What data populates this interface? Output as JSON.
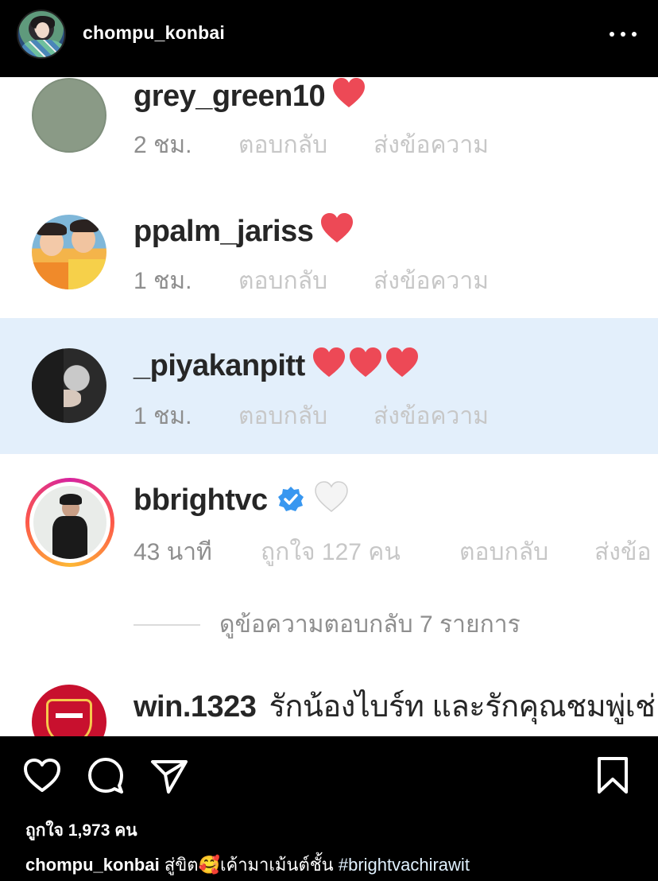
{
  "header": {
    "username": "chompu_konbai",
    "more_icon": "more-horizontal-icon"
  },
  "comments": [
    {
      "username": "grey_green10",
      "reaction": "❤️",
      "time": "2 ชม.",
      "reply": "ตอบกลับ",
      "send": "ส่งข้อความ",
      "avatar_color": "#8a9a86",
      "highlighted": false
    },
    {
      "username": "ppalm_jariss",
      "reaction": "❤️",
      "time": "1 ชม.",
      "reply": "ตอบกลับ",
      "send": "ส่งข้อความ",
      "highlighted": false
    },
    {
      "username": "_piyakanpitt",
      "reaction": "❤️❤️❤️",
      "time": "1 ชม.",
      "reply": "ตอบกลับ",
      "send": "ส่งข้อความ",
      "highlighted": true
    },
    {
      "username": "bbrightvc",
      "verified": true,
      "reaction": "🤍",
      "time": "43 นาที",
      "likes": "ถูกใจ 127 คน",
      "reply": "ตอบกลับ",
      "send": "ส่งข้อ",
      "highlighted": false
    },
    {
      "username": "win.1323",
      "text": "รักน้องไบร์ท และรักคุณชมพู่เช่",
      "highlighted": false
    }
  ],
  "view_replies": "ดูข้อความตอบกลับ 7 รายการ",
  "colors": {
    "highlight_bg": "#e3effb",
    "heart_red": "#ed4956",
    "verified_blue": "#3897f0"
  },
  "actions": {
    "like_icon": "heart-outline-icon",
    "comment_icon": "comment-bubble-icon",
    "share_icon": "send-paper-plane-icon",
    "save_icon": "bookmark-icon"
  },
  "post": {
    "likes": "ถูกใจ 1,973 คน",
    "caption_user": "chompu_konbai",
    "caption_text": "สู่ขิต🥰เค้ามาเม้นต์ชั้น",
    "caption_tag": "#brightvachirawit"
  }
}
